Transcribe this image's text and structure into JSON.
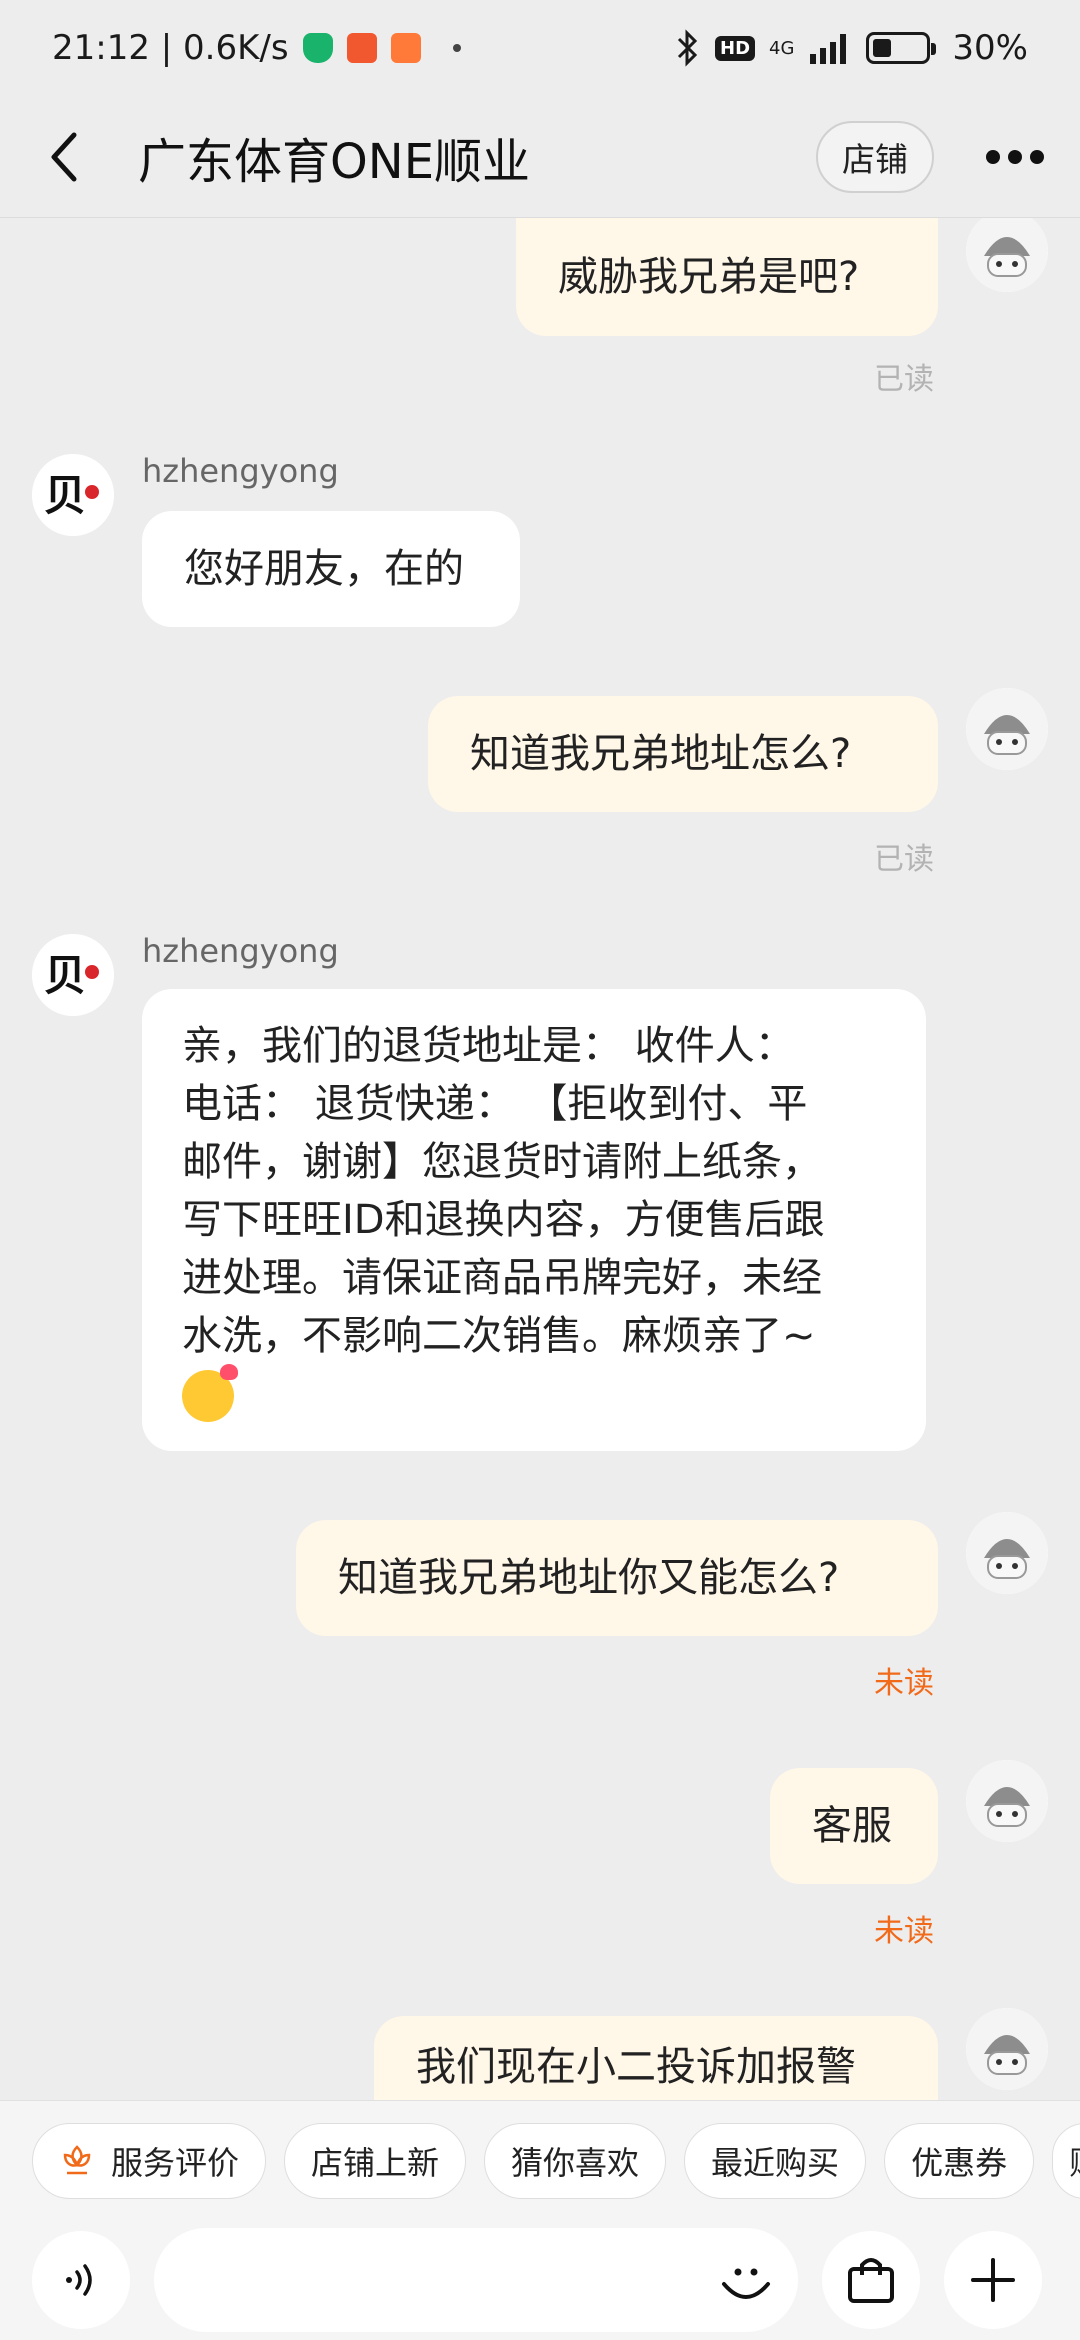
{
  "status_bar": {
    "time_speed": "21:12 | 0.6K/s",
    "network": "4G",
    "hd": "HD",
    "battery": "30%"
  },
  "header": {
    "title": "广东体育ONE顺业",
    "shop_label": "店铺"
  },
  "messages": [
    {
      "sender": "me",
      "text": "威胁我兄弟是吧?",
      "status": "已读"
    },
    {
      "sender": "shop",
      "name": "hzhengyong",
      "text": "您好朋友，在的"
    },
    {
      "sender": "me",
      "text": "知道我兄弟地址怎么?",
      "status": "已读"
    },
    {
      "sender": "shop",
      "name": "hzhengyong",
      "lines": [
        "亲，我们的退货地址是：  收件人：",
        "电话：  退货快递：  【拒收到付、平",
        "邮件，谢谢】您退货时请附上纸条，",
        "写下旺旺ID和退换内容，方便售后跟",
        "进处理。请保证商品吊牌完好，未经",
        "水洗，不影响二次销售。麻烦亲了~"
      ]
    },
    {
      "sender": "me",
      "text": "知道我兄弟地址你又能怎么?",
      "status": "未读"
    },
    {
      "sender": "me",
      "text": "客服",
      "status": "未读"
    },
    {
      "sender": "me",
      "text": "我们现在小二投诉加报警"
    }
  ],
  "quick_actions": [
    "服务评价",
    "店铺上新",
    "猜你喜欢",
    "最近购买",
    "优惠券",
    "赠"
  ],
  "colors": {
    "background": "#ededed",
    "outgoing_bubble": "#fff7e8",
    "incoming_bubble": "#ffffff",
    "unread": "#f06a1a",
    "read": "#b3b3b3"
  }
}
